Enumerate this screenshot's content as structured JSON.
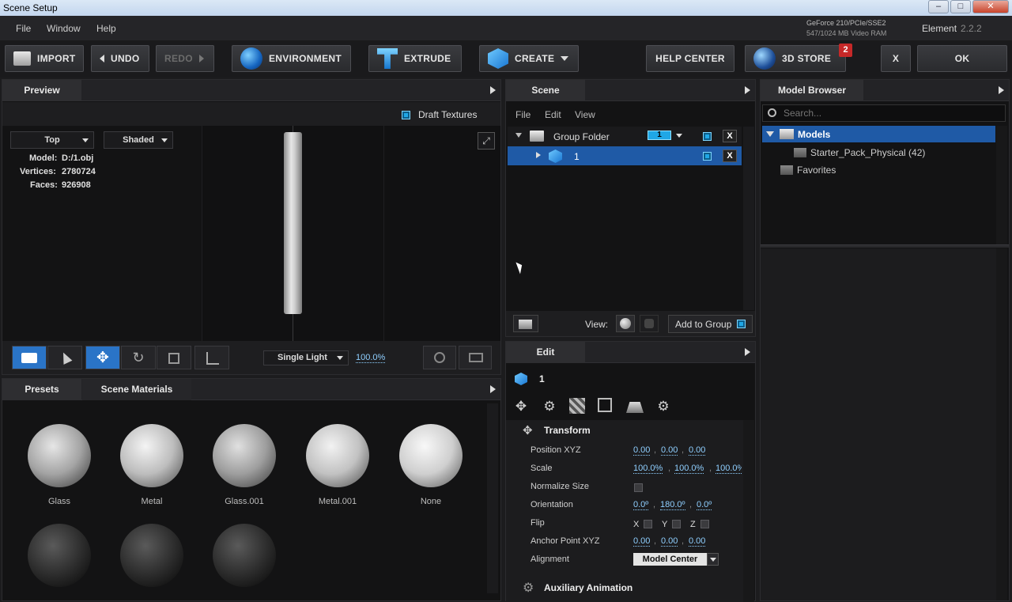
{
  "window": {
    "title": "Scene Setup",
    "min": "–",
    "max": "□",
    "close": "✕"
  },
  "menu": {
    "file": "File",
    "window": "Window",
    "help": "Help"
  },
  "gpu": {
    "line1": "GeForce 210/PCIe/SSE2",
    "line2": "547/1024 MB Video RAM"
  },
  "product": {
    "name": "Element",
    "version": "2.2.2"
  },
  "toolbar": {
    "import": "IMPORT",
    "undo": "UNDO",
    "redo": "REDO",
    "environment": "ENVIRONMENT",
    "extrude": "EXTRUDE",
    "create": "CREATE",
    "help_center": "HELP CENTER",
    "store": "3D STORE",
    "store_badge": "2",
    "close": "X",
    "ok": "OK"
  },
  "preview": {
    "tab": "Preview",
    "draft_textures": "Draft Textures",
    "view": "Top",
    "shading": "Shaded",
    "model_label": "Model:",
    "model_value": "D:/1.obj",
    "vertices_label": "Vertices:",
    "vertices_value": "2780724",
    "faces_label": "Faces:",
    "faces_value": "926908",
    "light": "Single Light",
    "zoom": "100.0%"
  },
  "scene": {
    "tab": "Scene",
    "menu_file": "File",
    "menu_edit": "Edit",
    "menu_view": "View",
    "group_name": "Group Folder",
    "group_count": "1",
    "item_name": "1",
    "view_label": "View:",
    "add_to_group": "Add to Group"
  },
  "browser": {
    "tab": "Model Browser",
    "search_placeholder": "Search...",
    "models": "Models",
    "starter": "Starter_Pack_Physical (42)",
    "favorites": "Favorites"
  },
  "materials": {
    "tab_presets": "Presets",
    "tab_scene": "Scene Materials",
    "items": [
      "Glass",
      "Metal",
      "Glass.001",
      "Metal.001",
      "None"
    ]
  },
  "edit": {
    "tab": "Edit",
    "object_name": "1",
    "transform": "Transform",
    "position_label": "Position XYZ",
    "position": [
      "0.00",
      "0.00",
      "0.00"
    ],
    "scale_label": "Scale",
    "scale": [
      "100.0%",
      "100.0%",
      "100.0%"
    ],
    "normalize_label": "Normalize Size",
    "orientation_label": "Orientation",
    "orientation": [
      "0.0º",
      "180.0º",
      "0.0º"
    ],
    "flip_label": "Flip",
    "flip_x": "X",
    "flip_y": "Y",
    "flip_z": "Z",
    "anchor_label": "Anchor Point XYZ",
    "anchor": [
      "0.00",
      "0.00",
      "0.00"
    ],
    "alignment_label": "Alignment",
    "alignment_value": "Model Center",
    "aux": "Auxiliary Animation"
  },
  "colors": {
    "accent": "#1fa7e6",
    "selection": "#1f5aa6"
  }
}
